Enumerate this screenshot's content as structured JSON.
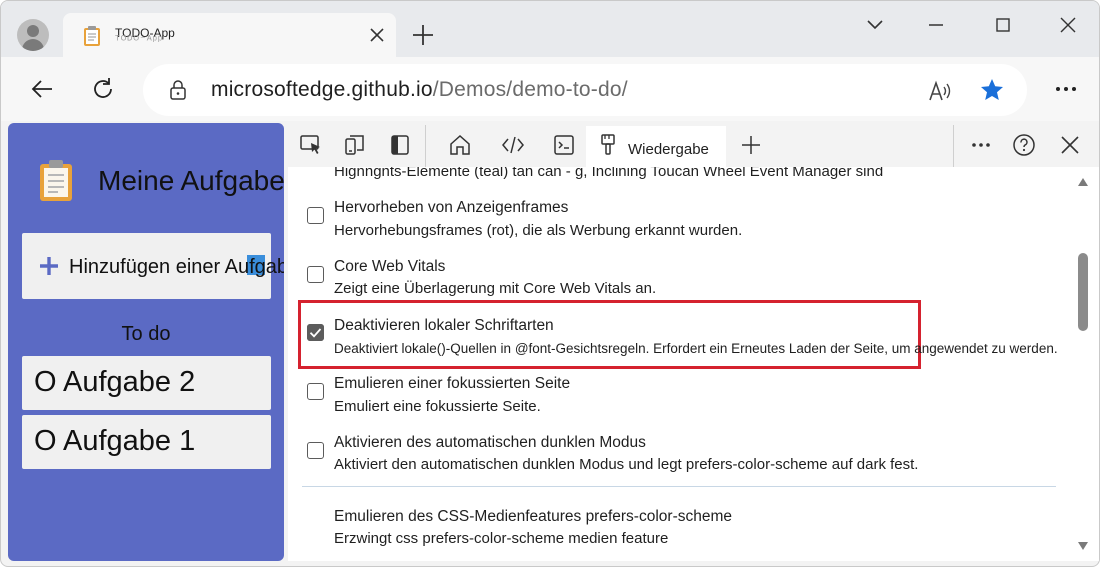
{
  "browser": {
    "tab_title": "TODO-App",
    "tab_title_ghost": "ᵀᴼᴰᴼ⁻ᴬᵖᵖ",
    "url_host": "microsoftedge.github.io",
    "url_path": "/Demos/demo-to-do/",
    "accent": "#1a73e8"
  },
  "app": {
    "title": "Meine Aufgaben",
    "add_button_label": "Hinzufügen einer Aufgabe",
    "section_heading": "To do",
    "tasks": [
      "O Aufgabe 2",
      "O Aufgabe 1"
    ],
    "background": "#5b6ac4"
  },
  "devtools": {
    "active_tab_label": "Wiedergabe",
    "options": [
      {
        "title": "",
        "desc": "Hignngnts-Elemente (teal) tan can - g, Inclining Toucan Wheel Event Manager sind",
        "checked": false
      },
      {
        "title": "Hervorheben von Anzeigenframes",
        "desc": "Hervorhebungsframes (rot), die als Werbung erkannt wurden.",
        "checked": false
      },
      {
        "title": "Core Web Vitals",
        "desc": "Zeigt eine Überlagerung mit Core Web Vitals an.",
        "checked": false
      },
      {
        "title": "Deaktivieren lokaler Schriftarten",
        "desc": "Deaktiviert lokale()-Quellen in @font-Gesichtsregeln. Erfordert ein Erneutes Laden der Seite, um angewendet zu werden.",
        "checked": true
      },
      {
        "title": "Emulieren einer fokussierten Seite",
        "desc": "Emuliert eine fokussierte Seite.",
        "checked": false
      },
      {
        "title": "Aktivieren des automatischen dunklen Modus",
        "desc": "Aktiviert den automatischen dunklen Modus und legt prefers-color-scheme auf dark fest.",
        "checked": false
      },
      {
        "title": "Emulieren des CSS-Medienfeatures prefers-color-scheme",
        "desc": "Erzwingt css prefers-color-scheme medien feature",
        "checked": false
      }
    ],
    "highlight_color": "#d5222f"
  }
}
